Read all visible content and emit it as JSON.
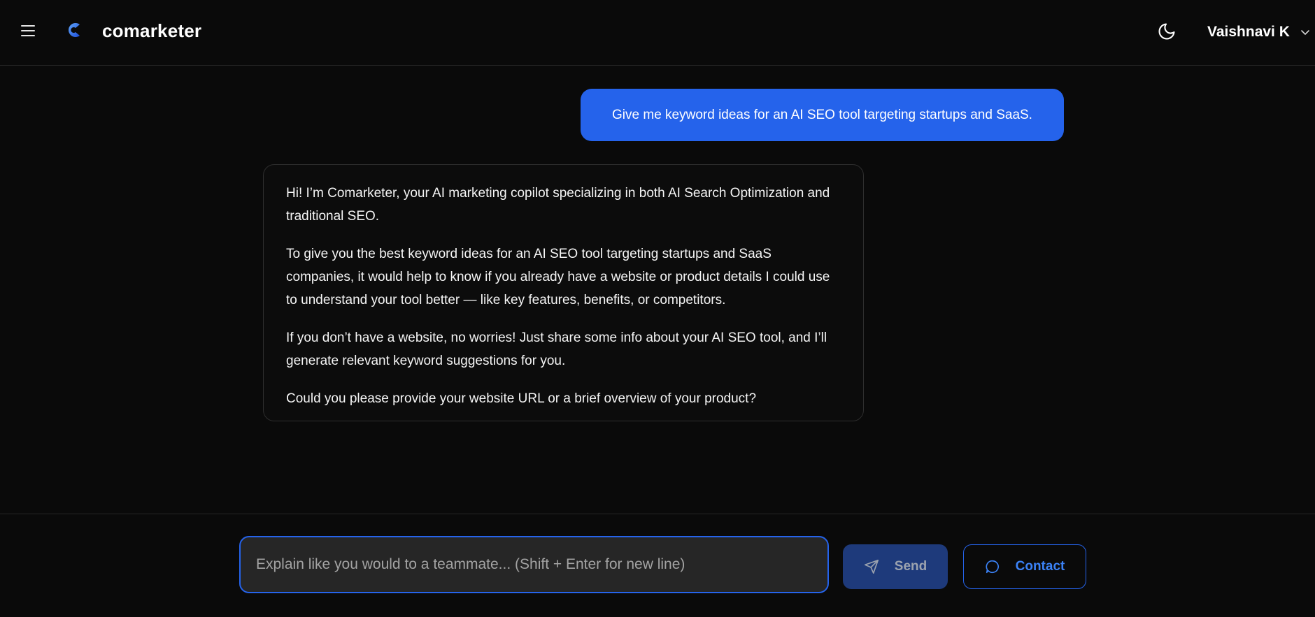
{
  "header": {
    "brand": "comarketer",
    "user_name": "Vaishnavi K",
    "icons": {
      "menu": "menu-icon",
      "logo": "comarketer-logo",
      "theme": "moon-icon",
      "user_menu": "chevron-down-icon"
    },
    "accent": "#2563eb"
  },
  "chat": {
    "user_message": "Give me keyword ideas for an AI SEO tool targeting startups and SaaS.",
    "assistant_paragraphs": [
      "Hi! I’m Comarketer, your AI marketing copilot specializing in both AI Search Optimization and traditional SEO.",
      "To give you the best keyword ideas for an AI SEO tool targeting startups and SaaS companies, it would help to know if you already have a website or product details I could use to understand your tool better — like key features, benefits, or competitors.",
      "If you don’t have a website, no worries! Just share some info about your AI SEO tool, and I’ll generate relevant keyword suggestions for you.",
      "Could you please provide your website URL or a brief overview of your product?"
    ]
  },
  "composer": {
    "placeholder": "Explain like you would to a teammate... (Shift + Enter for new line)",
    "value": "",
    "send_label": "Send",
    "contact_label": "Contact",
    "icons": {
      "send": "paper-plane-icon",
      "contact": "chat-bubble-icon"
    }
  }
}
